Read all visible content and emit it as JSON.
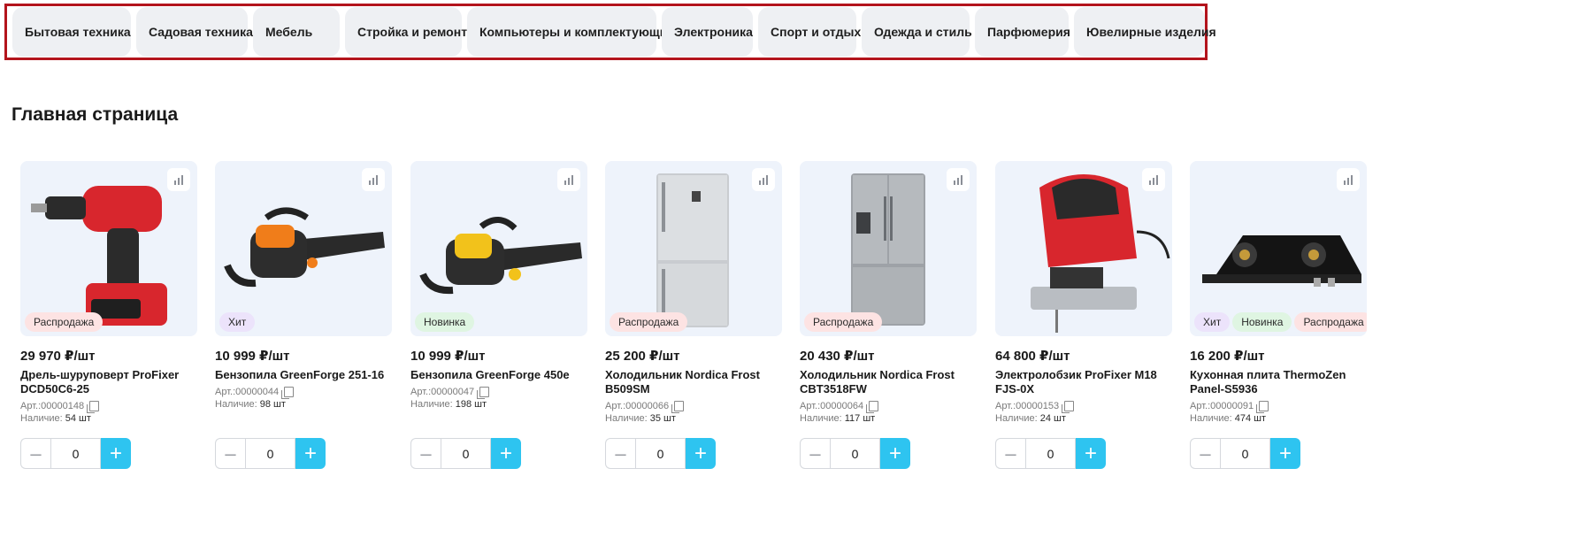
{
  "categories": [
    "Бытовая техника",
    "Садовая техника",
    "Мебель",
    "Стройка и ремонт",
    "Компьютеры и комплектующие",
    "Электроника",
    "Спорт и отдых",
    "Одежда и стиль",
    "Парфюмерия",
    "Ювелирные изделия"
  ],
  "page_title": "Главная страница",
  "labels": {
    "art_prefix": "Арт.:",
    "stock_prefix": "Наличие:"
  },
  "colors": {
    "accent": "#2ec4f0",
    "highlight_border": "#b3141c"
  },
  "products": [
    {
      "image": "drill",
      "badges": [
        "Распродажа"
      ],
      "price": "29 970 ₽/шт",
      "name": "Дрель-шуруповерт ProFixer DCD50C6-25",
      "art": "00000148",
      "stock": "54 шт",
      "qty": "0"
    },
    {
      "image": "chainsaw-orange",
      "badges": [
        "Хит"
      ],
      "price": "10 999 ₽/шт",
      "name": "Бензопила GreenForge 251-16",
      "art": "00000044",
      "stock": "98 шт",
      "qty": "0"
    },
    {
      "image": "chainsaw-yellow",
      "badges": [
        "Новинка"
      ],
      "price": "10 999 ₽/шт",
      "name": "Бензопила GreenForge 450e",
      "art": "00000047",
      "stock": "198 шт",
      "qty": "0"
    },
    {
      "image": "fridge-single",
      "badges": [
        "Распродажа"
      ],
      "price": "25 200 ₽/шт",
      "name": "Холодильник Nordica Frost B509SM",
      "art": "00000066",
      "stock": "35 шт",
      "qty": "0"
    },
    {
      "image": "fridge-double",
      "badges": [
        "Распродажа"
      ],
      "price": "20 430 ₽/шт",
      "name": "Холодильник Nordica Frost CBT3518FW",
      "art": "00000064",
      "stock": "117 шт",
      "qty": "0"
    },
    {
      "image": "jigsaw",
      "badges": [],
      "price": "64 800 ₽/шт",
      "name": "Электролобзик ProFixer M18 FJS-0X",
      "art": "00000153",
      "stock": "24 шт",
      "qty": "0"
    },
    {
      "image": "gas-stove",
      "badges": [
        "Хит",
        "Новинка",
        "Распродажа"
      ],
      "price": "16 200 ₽/шт",
      "name": "Кухонная плита ThermoZen Panel-S5936",
      "art": "00000091",
      "stock": "474 шт",
      "qty": "0"
    }
  ]
}
